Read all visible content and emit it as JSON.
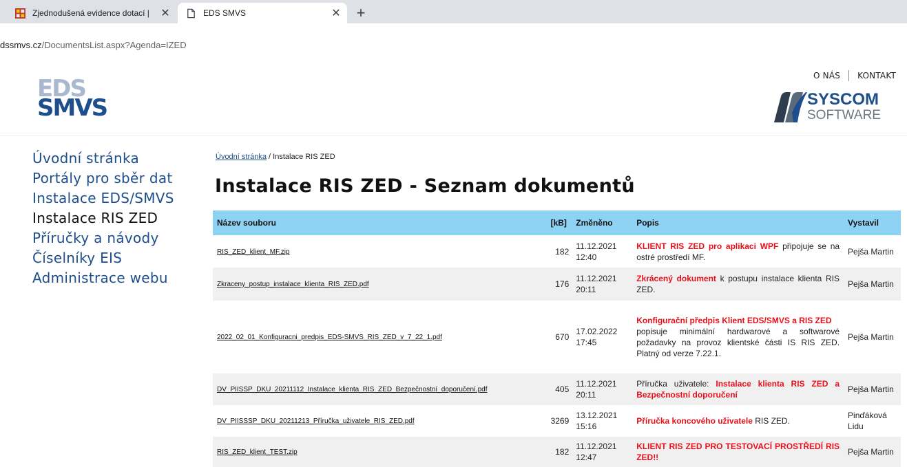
{
  "browser": {
    "tabs": [
      {
        "title": "Zjednodušená evidence dotací | "
      },
      {
        "title": "EDS SMVS"
      }
    ],
    "url": {
      "host": "dssmvs.cz",
      "path": "/DocumentsList.aspx?Agenda=IZED"
    }
  },
  "header": {
    "logo_text": "EDS SMVS",
    "nav": [
      {
        "label": "O NÁS"
      },
      {
        "label": "KONTAKT"
      }
    ],
    "partner_logo": {
      "line1": "SYSCOM",
      "line2": "SOFTWARE"
    }
  },
  "sidebar": {
    "items": [
      {
        "label": "Úvodní stránka"
      },
      {
        "label": "Portály pro sběr dat"
      },
      {
        "label": "Instalace EDS/SMVS"
      },
      {
        "label": "Instalace RIS ZED"
      },
      {
        "label": "Příručky a návody"
      },
      {
        "label": "Číselníky EIS"
      },
      {
        "label": "Administrace webu"
      }
    ]
  },
  "breadcrumb": {
    "home": "Úvodní stránka",
    "separator": " / ",
    "current": "Instalace RIS ZED"
  },
  "page": {
    "title": "Instalace RIS ZED - Seznam dokumentů"
  },
  "table": {
    "headers": {
      "file": "Název souboru",
      "size": "[kB]",
      "date": "Změněno",
      "desc": "Popis",
      "by": "Vystavil"
    },
    "rows": [
      {
        "file": "RIS_ZED_klient_MF.zip",
        "size": "182",
        "date": "11.12.2021",
        "time": "12:40",
        "desc_red": "KLIENT RIS ZED pro aplikaci WPF",
        "desc": " připojuje se na ostré prostředí MF.",
        "by": "Pejša Martin"
      },
      {
        "file": "Zkraceny_postup_instalace_klienta_RIS_ZED.pdf",
        "size": "176",
        "date": "11.12.2021",
        "time": "20:11",
        "desc_red": "Zkrácený dokument",
        "desc": " k postupu instalace klienta RIS ZED.",
        "by": "Pejša Martin"
      },
      {
        "file": "2022_02_01_Konfiguracni_predpis_EDS-SMVS_RIS_ZED_v_7_22_1.pdf",
        "size": "670",
        "date": "17.02.2022",
        "time": "17:45",
        "desc_red": "Konfigurační předpis Klient EDS/SMVS a RIS ZED",
        "desc": "popisuje minimální hardwarové a softwarové požadavky na provoz klientské části IS RIS ZED. Platný od verze 7.22.1.",
        "by": "Pejša Martin"
      },
      {
        "file": "DV_PIISSP_DKU_20211112_Instalace_klienta_RIS_ZED_Bezpečnostní_doporučení.pdf",
        "size": "405",
        "date": "11.12.2021",
        "time": "20:11",
        "desc_pre": "Příručka uživatele: ",
        "desc_red": "Instalace klienta RIS ZED a Bezpečnostní doporučení",
        "by": "Pejša Martin"
      },
      {
        "file": "DV_PIISSSP_DKU_20211213_Příručka_uživatele_RIS_ZED.pdf",
        "size": "3269",
        "date": "13.12.2021",
        "time": "15:16",
        "desc_red": "Příručka koncového uživatele",
        "desc": " RIS ZED.",
        "by": "Pinďáková Lidu"
      },
      {
        "file": "RIS_ZED_klient_TEST.zip",
        "size": "182",
        "date": "11.12.2021",
        "time": "12:47",
        "desc_red": "KLIENT RIS ZED PRO TESTOVACÍ PROSTŘEDÍ RIS ZED!!",
        "by": "Pejša Martin"
      }
    ]
  },
  "colors": {
    "accent": "#8ed3f4",
    "nav": "#1e4f8c",
    "highlight": "#e8101a",
    "logo_blue": "#1e4f8c"
  }
}
